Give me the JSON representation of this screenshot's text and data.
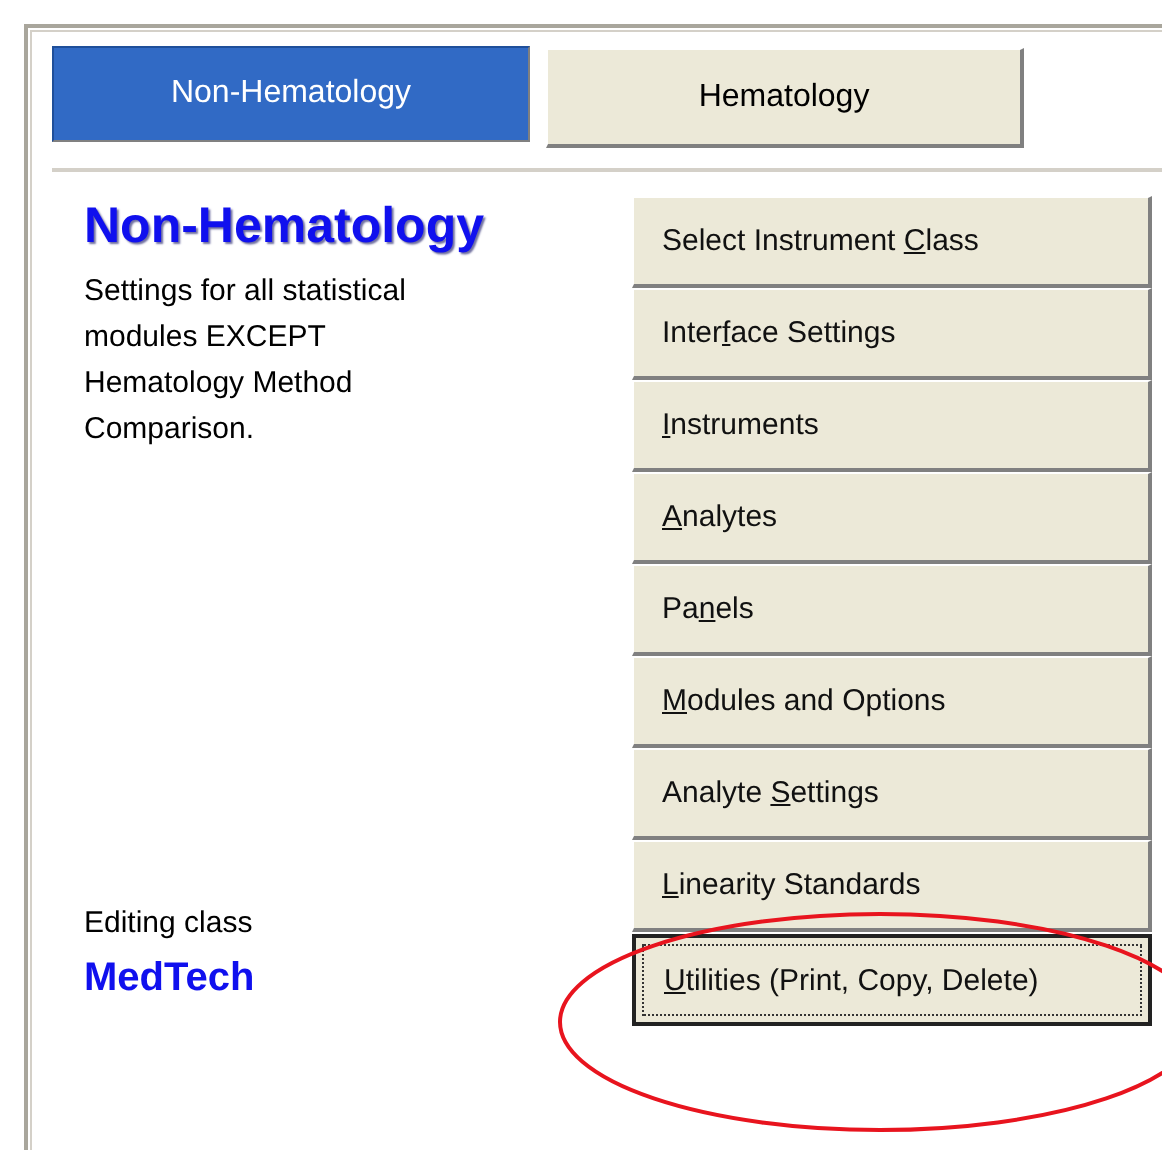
{
  "tabs": [
    {
      "label": "Non-Hematology",
      "selected": true
    },
    {
      "label": "Hematology",
      "selected": false
    }
  ],
  "heading": "Non-Hematology",
  "description": "Settings for all statistical modules EXCEPT Hematology Method Comparison.",
  "editing_label": "Editing class",
  "editing_value": "MedTech",
  "buttons": [
    {
      "before": "Select Instrument ",
      "key": "C",
      "after": "lass",
      "focused": false
    },
    {
      "before": "Inter",
      "key": "f",
      "after": "ace Settings",
      "focused": false
    },
    {
      "key": "I",
      "after": "nstruments",
      "focused": false
    },
    {
      "key": "A",
      "after": "nalytes",
      "focused": false
    },
    {
      "before": "Pa",
      "key": "n",
      "after": "els",
      "focused": false
    },
    {
      "key": "M",
      "after": "odules and Options",
      "focused": false
    },
    {
      "before": "Analyte ",
      "key": "S",
      "after": "ettings",
      "focused": false
    },
    {
      "key": "L",
      "after": "inearity Standards",
      "focused": false
    },
    {
      "key": "U",
      "after": "tilities (Print, Copy, Delete)",
      "focused": true
    }
  ],
  "annotation": {
    "kind": "ellipse"
  }
}
